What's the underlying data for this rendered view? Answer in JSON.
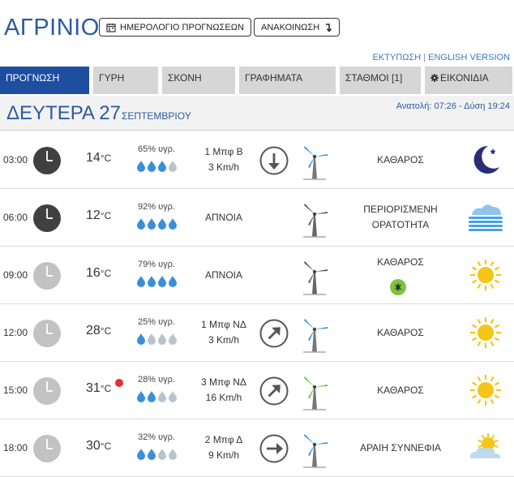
{
  "header": {
    "city": "ΑΓΡΙΝΙΟ",
    "calendar_button": "ΗΜΕΡΟΛΟΓΙΟ ΠΡΟΓΝΩΣΕΩΝ",
    "announce_button": "ΑΝΑΚΟΙΝΩΣΗ",
    "print_link": "ΕΚΤΥΠΩΣΗ",
    "separator": "|",
    "english_link": "ENGLISH VERSION"
  },
  "tabs": [
    {
      "label": "ΠΡΟΓΝΩΣΗ",
      "active": true
    },
    {
      "label": "ΓΥΡΗ",
      "active": false
    },
    {
      "label": "ΣΚΟΝΗ",
      "active": false
    },
    {
      "label": "ΓΡΑΦΗΜΑΤΑ",
      "active": false
    },
    {
      "label": "ΣΤΑΘΜΟΙ [1]",
      "active": false
    },
    {
      "label": "ΕΙΚΟΝΙΔΙΑ",
      "active": false
    }
  ],
  "day": {
    "name": "ΔΕΥΤΕΡΑ 27",
    "month": "ΣΕΠΤΕΜΒΡΙΟΥ",
    "sun": "Ανατολή: 07:26 - Δύση 19:24"
  },
  "temp_unit": "°C",
  "colors": {
    "accent": "#1e4ea0",
    "city": "#2c5aa0",
    "drop_filled": "#3a8fd9",
    "drop_empty": "#b8c4cc",
    "sun": "#f5c518",
    "moon": "#2a2c7a",
    "hot_dot": "#e53030"
  },
  "rows": [
    {
      "time": "03:00",
      "clock": "dark",
      "temp": "14",
      "hot": false,
      "humidity": "65% υγρ.",
      "drops_filled": 3,
      "wind_1": "1 Μπφ Β",
      "wind_2": "3 Km/h",
      "calm": false,
      "arrow": "down",
      "turbine": "blue",
      "cond_1": "ΚΑΘΑΡΟΣ",
      "cond_2": "",
      "pollen": false,
      "icon": "moon-icon"
    },
    {
      "time": "06:00",
      "clock": "dark",
      "temp": "12",
      "hot": false,
      "humidity": "92% υγρ.",
      "drops_filled": 4,
      "wind_1": "ΑΠΝΟΙΑ",
      "wind_2": "",
      "calm": true,
      "arrow": "",
      "turbine": "gray",
      "cond_1": "ΠΕΡΙΟΡΙΣΜΕΝΗ",
      "cond_2": "ΟΡΑΤΟΤΗΤΑ",
      "pollen": false,
      "icon": "fog-icon"
    },
    {
      "time": "09:00",
      "clock": "light",
      "temp": "16",
      "hot": false,
      "humidity": "79% υγρ.",
      "drops_filled": 4,
      "wind_1": "ΑΠΝΟΙΑ",
      "wind_2": "",
      "calm": true,
      "arrow": "",
      "turbine": "gray",
      "cond_1": "ΚΑΘΑΡΟΣ",
      "cond_2": "",
      "pollen": true,
      "icon": "sun-icon"
    },
    {
      "time": "12:00",
      "clock": "light",
      "temp": "28",
      "hot": false,
      "humidity": "25% υγρ.",
      "drops_filled": 1,
      "wind_1": "1 Μπφ ΝΔ",
      "wind_2": "3 Km/h",
      "calm": false,
      "arrow": "ne",
      "turbine": "blue",
      "cond_1": "ΚΑΘΑΡΟΣ",
      "cond_2": "",
      "pollen": false,
      "icon": "sun-icon"
    },
    {
      "time": "15:00",
      "clock": "light",
      "temp": "31",
      "hot": true,
      "humidity": "28% υγρ.",
      "drops_filled": 2,
      "wind_1": "3 Μπφ ΝΔ",
      "wind_2": "16 Km/h",
      "calm": false,
      "arrow": "ne",
      "turbine": "green",
      "cond_1": "ΚΑΘΑΡΟΣ",
      "cond_2": "",
      "pollen": false,
      "icon": "sun-icon"
    },
    {
      "time": "18:00",
      "clock": "light",
      "temp": "30",
      "hot": false,
      "humidity": "32% υγρ.",
      "drops_filled": 2,
      "wind_1": "2 Μπφ Δ",
      "wind_2": "9 Km/h",
      "calm": false,
      "arrow": "right",
      "turbine": "blue",
      "cond_1": "ΑΡΑΙΗ ΣΥΝΝΕΦΙΑ",
      "cond_2": "",
      "pollen": false,
      "icon": "partly-cloudy-icon"
    }
  ]
}
